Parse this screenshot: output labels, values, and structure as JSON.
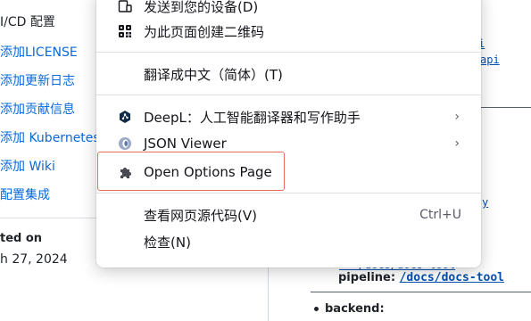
{
  "left": {
    "top_text": "I/CD 配置",
    "links": [
      "添加LICENSE",
      "添加更新日志",
      "添加贡献信息",
      "添加 Kubernetes 集",
      "添加 Wiki",
      "配置集成"
    ],
    "updated_label": "ted on",
    "updated_date": "h 27, 2024"
  },
  "right": {
    "snippet1": "i",
    "snippet2": "api",
    "snippet3": "y",
    "cut_text": "--  /docs/docs-tool",
    "pipeline_key": "pipeline:",
    "pipeline_link": "/docs/docs-tool",
    "backend_key": "backend:"
  },
  "menu": {
    "send_device": "发送到您的设备(D)",
    "qr_code": "为此页面创建二维码",
    "translate": "翻译成中文（简体）(T)",
    "deepl": "DeepL：人工智能翻译器和写作助手",
    "json_viewer": "JSON Viewer",
    "open_options": "Open Options Page",
    "view_source": "查看网页源代码(V)",
    "view_source_shortcut": "Ctrl+U",
    "inspect": "检查(N)",
    "submenu_arrow": "›"
  },
  "icons": {
    "send_device": "device-icon",
    "qr_code": "qr-code-icon",
    "deepl": "deepl-icon",
    "json_viewer": "json-viewer-icon",
    "open_options": "puzzle-icon"
  },
  "colors": {
    "highlight": "#e2725b",
    "link": "#0969da"
  }
}
